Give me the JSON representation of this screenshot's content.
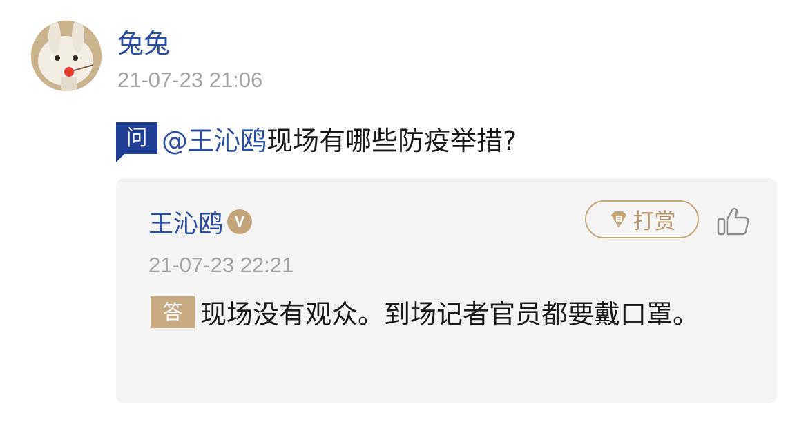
{
  "question": {
    "asker_name": "兔兔",
    "timestamp": "21-07-23 21:06",
    "badge": "问",
    "mention": "@王沁鸥",
    "text": "现场有哪些防疫举措?"
  },
  "answer": {
    "answerer_name": "王沁鸥",
    "verified_mark": "V",
    "tip_label": "打赏",
    "timestamp": "21-07-23 22:21",
    "badge": "答",
    "text": "现场没有观众。到场记者官员都要戴口罩。"
  },
  "icons": {
    "avatar": "rabbit-avatar",
    "tip": "gem-icon",
    "like": "thumbs-up-icon",
    "verified": "verified-badge-icon"
  },
  "colors": {
    "name_blue": "#2b4ea0",
    "question_badge": "#1e3f93",
    "answer_badge": "#c8ab82",
    "gold_accent": "#c6a77d",
    "timestamp_gray": "#a3a3a3",
    "card_bg": "#f4f4f4"
  }
}
